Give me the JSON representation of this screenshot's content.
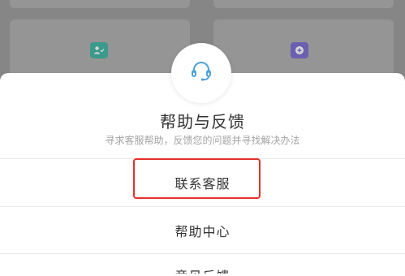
{
  "sheet": {
    "title": "帮助与反馈",
    "subtitle": "寻求客服帮助，反馈您的问题并寻找解决办法",
    "icon": "headset-icon",
    "accent_color": "#4fa3d8"
  },
  "menu": {
    "items": [
      {
        "label": "联系客服",
        "highlighted": true
      },
      {
        "label": "帮助中心"
      },
      {
        "label": "意见反馈"
      }
    ]
  },
  "background": {
    "icons": [
      "person-check-icon",
      "plus-circle-icon"
    ],
    "icon_colors": [
      "#3b9a8c",
      "#6a5fb0"
    ]
  },
  "highlight_color": "#e5302a"
}
